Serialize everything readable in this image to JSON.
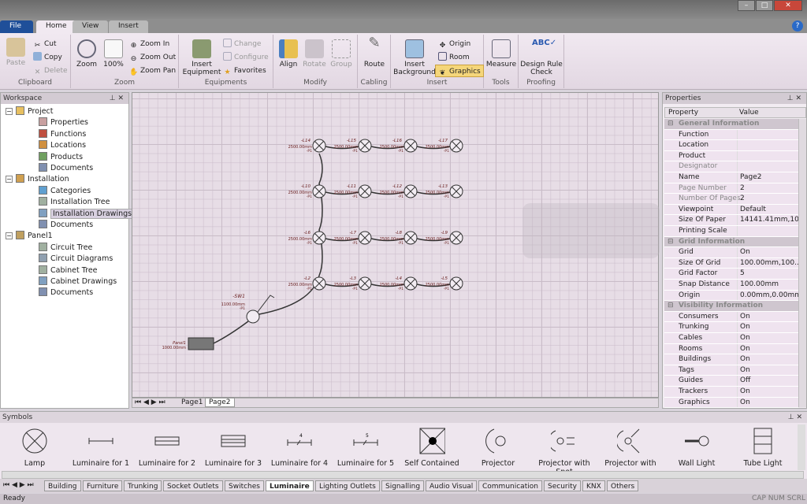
{
  "ribbon": {
    "tabs": [
      "File",
      "Home",
      "View",
      "Insert"
    ],
    "groups": {
      "clipboard": "Clipboard",
      "zoom": "Zoom",
      "equipments": "Equipments",
      "modify": "Modify",
      "cabling": "Cabling",
      "insert": "Insert",
      "tools": "Tools",
      "proofing": "Proofing"
    },
    "buttons": {
      "paste": "Paste",
      "cut": "Cut",
      "copy": "Copy",
      "delete": "Delete",
      "zoom": "Zoom",
      "zoom100": "100%",
      "zoom_in": "Zoom In",
      "zoom_out": "Zoom Out",
      "zoom_pan": "Zoom Pan",
      "insert_equipment": "Insert Equipment",
      "change": "Change",
      "configure": "Configure",
      "favorites": "Favorites",
      "align": "Align",
      "rotate": "Rotate",
      "group": "Group",
      "route": "Route",
      "insert_background": "Insert Background",
      "origin": "Origin",
      "room": "Room",
      "graphics": "Graphics",
      "measure": "Measure",
      "design_rule_check": "Design Rule Check"
    }
  },
  "workspace": {
    "title": "Workspace",
    "items": [
      {
        "label": "Project",
        "level": 0,
        "icon": "folder-icon"
      },
      {
        "label": "Properties",
        "level": 1,
        "icon": "properties-icon"
      },
      {
        "label": "Functions",
        "level": 1,
        "icon": "functions-icon"
      },
      {
        "label": "Locations",
        "level": 1,
        "icon": "locations-icon"
      },
      {
        "label": "Products",
        "level": 1,
        "icon": "products-icon"
      },
      {
        "label": "Documents",
        "level": 1,
        "icon": "documents-icon"
      },
      {
        "label": "Installation",
        "level": 0,
        "icon": "installation-icon"
      },
      {
        "label": "Categories",
        "level": 1,
        "icon": "categories-icon"
      },
      {
        "label": "Installation Tree",
        "level": 1,
        "icon": "tree-icon"
      },
      {
        "label": "Installation Drawings",
        "level": 1,
        "icon": "drawings-icon",
        "selected": true
      },
      {
        "label": "Documents",
        "level": 1,
        "icon": "documents-icon"
      },
      {
        "label": "Panel1",
        "level": 0,
        "icon": "panel-icon"
      },
      {
        "label": "Circuit Tree",
        "level": 1,
        "icon": "tree-icon"
      },
      {
        "label": "Circuit Diagrams",
        "level": 1,
        "icon": "diagram-icon"
      },
      {
        "label": "Cabinet Tree",
        "level": 1,
        "icon": "tree-icon"
      },
      {
        "label": "Cabinet Drawings",
        "level": 1,
        "icon": "drawings-icon"
      },
      {
        "label": "Documents",
        "level": 1,
        "icon": "documents-icon"
      }
    ]
  },
  "drawing": {
    "rows": [
      [
        "-L14",
        "-L15",
        "-L16",
        "-L17"
      ],
      [
        "-L10",
        "-L11",
        "-L12",
        "-L13"
      ],
      [
        "-L6",
        "-L7",
        "-L8",
        "-L9"
      ],
      [
        "-L2",
        "-L3",
        "-L4",
        "-L5"
      ]
    ],
    "lamp_height": "2500.00mm",
    "lamp_phase": "-P1",
    "switch": {
      "label": "-SW1",
      "height": "1100.00mm",
      "phase": "-P1"
    },
    "panel": {
      "label": "Panel1",
      "height": "1000.00mm"
    },
    "page_tabs": [
      "Page1",
      "Page2"
    ],
    "active_page": "Page2"
  },
  "properties": {
    "title": "Properties",
    "col_property": "Property",
    "col_value": "Value",
    "rows": [
      {
        "section": "General Information"
      },
      {
        "k": "Function",
        "v": ""
      },
      {
        "k": "Location",
        "v": ""
      },
      {
        "k": "Product",
        "v": ""
      },
      {
        "k": "Designator",
        "v": "",
        "dim": true
      },
      {
        "k": "Name",
        "v": "Page2"
      },
      {
        "k": "Page Number",
        "v": "2",
        "dim": true
      },
      {
        "k": "Number Of Pages",
        "v": "2",
        "dim": true
      },
      {
        "k": "Viewpoint",
        "v": "Default"
      },
      {
        "k": "Size Of Paper",
        "v": "14141.41mm,10..."
      },
      {
        "k": "Printing Scale",
        "v": ""
      },
      {
        "section": "Grid Information"
      },
      {
        "k": "Grid",
        "v": "On"
      },
      {
        "k": "Size Of Grid",
        "v": "100.00mm,100...."
      },
      {
        "k": "Grid Factor",
        "v": "5"
      },
      {
        "k": "Snap Distance",
        "v": "100.00mm"
      },
      {
        "k": "Origin",
        "v": "0.00mm,0.00mm"
      },
      {
        "section": "Visibility Information"
      },
      {
        "k": "Consumers",
        "v": "On"
      },
      {
        "k": "Trunking",
        "v": "On"
      },
      {
        "k": "Cables",
        "v": "On"
      },
      {
        "k": "Rooms",
        "v": "On"
      },
      {
        "k": "Buildings",
        "v": "On"
      },
      {
        "k": "Tags",
        "v": "On"
      },
      {
        "k": "Guides",
        "v": "Off"
      },
      {
        "k": "Trackers",
        "v": "On"
      },
      {
        "k": "Graphics",
        "v": "On"
      }
    ]
  },
  "symbols": {
    "title": "Symbols",
    "items": [
      "Lamp",
      "Luminaire for 1",
      "Luminaire for 2",
      "Luminaire for 3",
      "Luminaire for 4",
      "Luminaire for 5",
      "Self Contained",
      "Projector",
      "Projector with Spot",
      "Projector with",
      "Wall Light",
      "Tube Light"
    ],
    "tabs": [
      "Building",
      "Furniture",
      "Trunking",
      "Socket Outlets",
      "Switches",
      "Luminaire",
      "Lighting Outlets",
      "Signalling",
      "Audio Visual",
      "Communication",
      "Security",
      "KNX",
      "Others"
    ],
    "active_tab": "Luminaire"
  },
  "status": {
    "text": "Ready",
    "indicators": [
      "CAP",
      "NUM",
      "SCRL"
    ]
  }
}
